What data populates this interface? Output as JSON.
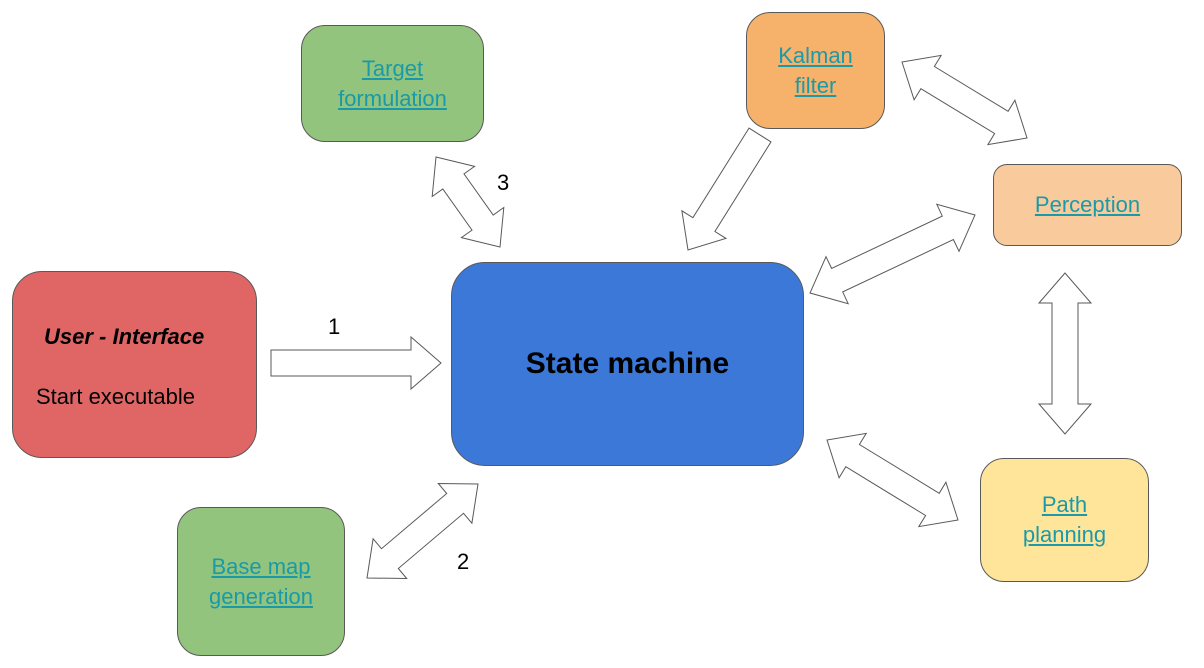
{
  "nodes": {
    "target": {
      "label_line1": "Target",
      "label_line2": "formulation",
      "color": "#93c47d"
    },
    "kalman": {
      "label_line1": "Kalman",
      "label_line2": "filter",
      "color": "#f6b26b"
    },
    "perception": {
      "label": "Perception",
      "color": "#f9cb9c"
    },
    "user_interface": {
      "title": "User - Interface",
      "subtitle": "Start executable",
      "color": "#e06666"
    },
    "state_machine": {
      "label": "State machine",
      "color": "#3c78d8"
    },
    "base_map": {
      "label_line1": "Base map",
      "label_line2": "generation",
      "color": "#93c47d"
    },
    "path_planning": {
      "label_line1": "Path",
      "label_line2": "planning",
      "color": "#ffe599"
    }
  },
  "edges": [
    {
      "from": "user_interface",
      "to": "state_machine",
      "direction": "one-way",
      "label": "1"
    },
    {
      "from": "state_machine",
      "to": "base_map",
      "direction": "two-way",
      "label": "2"
    },
    {
      "from": "state_machine",
      "to": "target",
      "direction": "two-way",
      "label": "3"
    },
    {
      "from": "kalman",
      "to": "state_machine",
      "direction": "one-way"
    },
    {
      "from": "kalman",
      "to": "perception",
      "direction": "two-way"
    },
    {
      "from": "perception",
      "to": "state_machine",
      "direction": "two-way"
    },
    {
      "from": "perception",
      "to": "path_planning",
      "direction": "two-way"
    },
    {
      "from": "path_planning",
      "to": "state_machine",
      "direction": "two-way"
    }
  ],
  "link_color": "#1a9aa9"
}
